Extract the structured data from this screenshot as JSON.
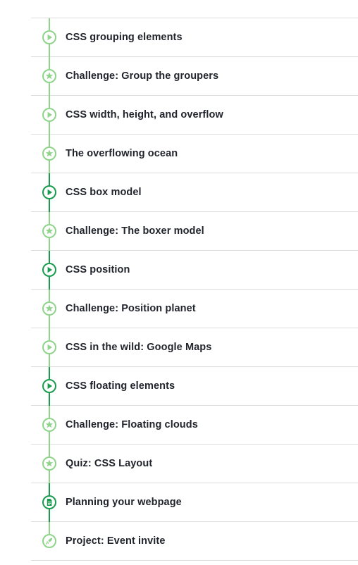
{
  "colors": {
    "light_green": "#8fd48a",
    "dark_green": "#1a9c4f",
    "text": "#21242c",
    "divider": "#dcdcdc"
  },
  "lessons": [
    {
      "label": "CSS grouping elements",
      "icon": "play-icon",
      "style": "light"
    },
    {
      "label": "Challenge: Group the groupers",
      "icon": "star-icon",
      "style": "light"
    },
    {
      "label": "CSS width, height, and overflow",
      "icon": "play-icon",
      "style": "light"
    },
    {
      "label": "The overflowing ocean",
      "icon": "star-icon",
      "style": "light"
    },
    {
      "label": "CSS box model",
      "icon": "play-icon",
      "style": "dark"
    },
    {
      "label": "Challenge: The boxer model",
      "icon": "star-icon",
      "style": "light"
    },
    {
      "label": "CSS position",
      "icon": "play-icon",
      "style": "dark"
    },
    {
      "label": "Challenge: Position planet",
      "icon": "star-icon",
      "style": "light"
    },
    {
      "label": "CSS in the wild: Google Maps",
      "icon": "play-icon",
      "style": "light"
    },
    {
      "label": "CSS floating elements",
      "icon": "play-icon",
      "style": "dark"
    },
    {
      "label": "Challenge: Floating clouds",
      "icon": "star-icon",
      "style": "light"
    },
    {
      "label": "Quiz: CSS Layout",
      "icon": "star-icon",
      "style": "light"
    },
    {
      "label": "Planning your webpage",
      "icon": "document-icon",
      "style": "dark"
    },
    {
      "label": "Project: Event invite",
      "icon": "rocket-icon",
      "style": "light"
    }
  ]
}
